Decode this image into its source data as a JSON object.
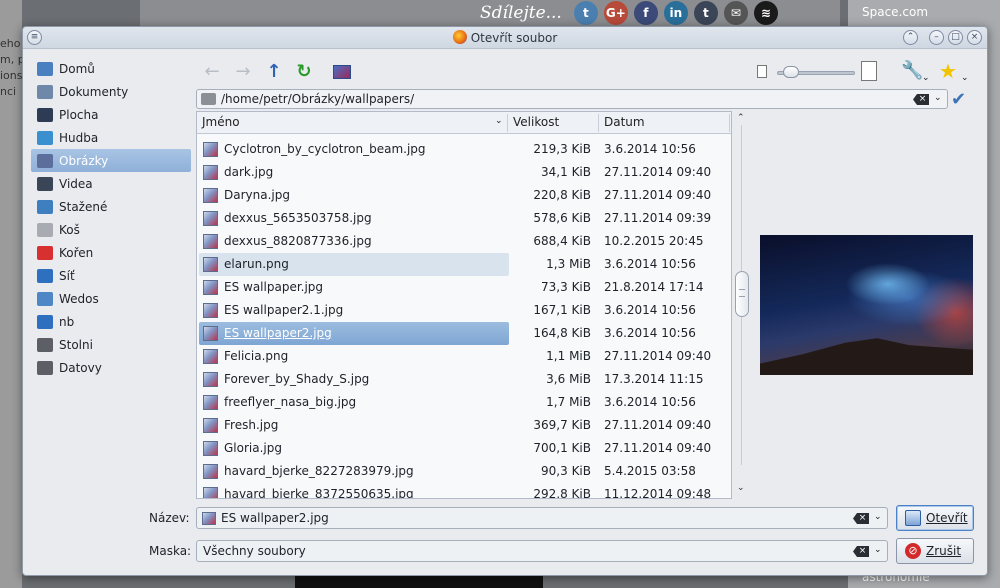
{
  "background": {
    "share_text": "Sdílejte...",
    "share_buttons": [
      "t",
      "G+",
      "f",
      "in",
      "t",
      "✉",
      "≋"
    ],
    "right_title": "Space.com",
    "right_bottom": "astronomie",
    "left_fragments": [
      "eho",
      "m, p",
      "ions",
      "nci"
    ]
  },
  "dialog": {
    "title": "Otevřít soubor",
    "titlebar_buttons": [
      "⌃",
      "–",
      "□",
      "×"
    ]
  },
  "sidebar": {
    "items": [
      {
        "label": "Domů",
        "icon": "home-icon",
        "color": "#4a7fc0"
      },
      {
        "label": "Dokumenty",
        "icon": "documents-icon",
        "color": "#6f87a8"
      },
      {
        "label": "Plocha",
        "icon": "desktop-icon",
        "color": "#2e3b55"
      },
      {
        "label": "Hudba",
        "icon": "music-icon",
        "color": "#3a8fcf"
      },
      {
        "label": "Obrázky",
        "icon": "pictures-icon",
        "color": "#5c6f9c"
      },
      {
        "label": "Videa",
        "icon": "videos-icon",
        "color": "#3a4558"
      },
      {
        "label": "Stažené",
        "icon": "downloads-icon",
        "color": "#3f7fbf"
      },
      {
        "label": "Koš",
        "icon": "trash-icon",
        "color": "#a8acb2"
      },
      {
        "label": "Kořen",
        "icon": "root-folder-icon",
        "color": "#d83030"
      },
      {
        "label": "Síť",
        "icon": "network-icon",
        "color": "#2f6fbf"
      },
      {
        "label": "Wedos",
        "icon": "network-folder-icon",
        "color": "#4f86c6"
      },
      {
        "label": "nb",
        "icon": "network-icon",
        "color": "#2f6fbf"
      },
      {
        "label": "Stolni",
        "icon": "drive-icon",
        "color": "#5c5f66"
      },
      {
        "label": "Datovy",
        "icon": "drive-icon",
        "color": "#5c5f66"
      }
    ],
    "selected_index": 4
  },
  "toolbar": {
    "back": "←",
    "forward": "→",
    "up": "↑",
    "reload": "↻",
    "zoom_level": 0.1
  },
  "path": {
    "value": "/home/petr/Obrázky/wallpapers/",
    "clear": "×",
    "dropdown": "⌄",
    "confirm": "✔"
  },
  "list": {
    "columns": {
      "name": "Jméno",
      "size": "Velikost",
      "date": "Datum"
    },
    "selected_index": 8,
    "hover_index": 5,
    "files": [
      {
        "name": "Cyclotron_by_cyclotron_beam.jpg",
        "size": "219,3 KiB",
        "date": "3.6.2014 10:56"
      },
      {
        "name": "dark.jpg",
        "size": "34,1 KiB",
        "date": "27.11.2014 09:40"
      },
      {
        "name": "Daryna.jpg",
        "size": "220,8 KiB",
        "date": "27.11.2014 09:40"
      },
      {
        "name": "dexxus_5653503758.jpg",
        "size": "578,6 KiB",
        "date": "27.11.2014 09:39"
      },
      {
        "name": "dexxus_8820877336.jpg",
        "size": "688,4 KiB",
        "date": "10.2.2015 20:45"
      },
      {
        "name": "elarun.png",
        "size": "1,3 MiB",
        "date": "3.6.2014 10:56"
      },
      {
        "name": "ES wallpaper.jpg",
        "size": "73,3 KiB",
        "date": "21.8.2014 17:14"
      },
      {
        "name": "ES wallpaper2.1.jpg",
        "size": "167,1 KiB",
        "date": "3.6.2014 10:56"
      },
      {
        "name": "ES wallpaper2.jpg",
        "size": "164,8 KiB",
        "date": "3.6.2014 10:56"
      },
      {
        "name": "Felicia.png",
        "size": "1,1 MiB",
        "date": "27.11.2014 09:40"
      },
      {
        "name": "Forever_by_Shady_S.jpg",
        "size": "3,6 MiB",
        "date": "17.3.2014 11:15"
      },
      {
        "name": "freeflyer_nasa_big.jpg",
        "size": "1,7 MiB",
        "date": "3.6.2014 10:56"
      },
      {
        "name": "Fresh.jpg",
        "size": "369,7 KiB",
        "date": "27.11.2014 09:40"
      },
      {
        "name": "Gloria.jpg",
        "size": "700,1 KiB",
        "date": "27.11.2014 09:40"
      },
      {
        "name": "havard_bjerke_8227283979.jpg",
        "size": "90,3 KiB",
        "date": "5.4.2015 03:58"
      },
      {
        "name": "havard_bjerke_8372550635.jpg",
        "size": "292,8 KiB",
        "date": "11.12.2014 09:48"
      }
    ]
  },
  "form": {
    "name_label": "Název:",
    "name_value": "ES wallpaper2.jpg",
    "filter_label": "Maska:",
    "filter_value": "Všechny soubory",
    "open_button": "Otevřít",
    "cancel_button": "Zrušit"
  }
}
